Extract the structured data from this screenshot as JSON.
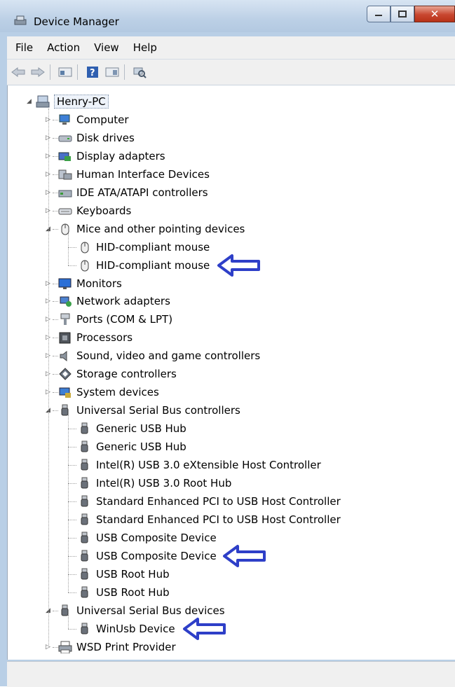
{
  "window": {
    "title": "Device Manager",
    "caption_buttons": [
      "minimize",
      "maximize",
      "close"
    ]
  },
  "menu": [
    "File",
    "Action",
    "View",
    "Help"
  ],
  "toolbar": [
    "back-icon",
    "forward-icon",
    "properties-icon",
    "help-icon",
    "update-driver-icon",
    "scan-hardware-icon"
  ],
  "tree": {
    "root": "Henry-PC",
    "categories": [
      {
        "label": "Computer",
        "icon": "computer-icon",
        "expanded": false
      },
      {
        "label": "Disk drives",
        "icon": "disk-drive-icon",
        "expanded": false
      },
      {
        "label": "Display adapters",
        "icon": "display-adapter-icon",
        "expanded": false
      },
      {
        "label": "Human Interface Devices",
        "icon": "hid-icon",
        "expanded": false
      },
      {
        "label": "IDE ATA/ATAPI controllers",
        "icon": "ide-controller-icon",
        "expanded": false
      },
      {
        "label": "Keyboards",
        "icon": "keyboard-icon",
        "expanded": false
      },
      {
        "label": "Mice and other pointing devices",
        "icon": "mouse-icon",
        "expanded": true,
        "children": [
          "HID-compliant mouse",
          "HID-compliant mouse"
        ]
      },
      {
        "label": "Monitors",
        "icon": "monitor-icon",
        "expanded": false
      },
      {
        "label": "Network adapters",
        "icon": "network-adapter-icon",
        "expanded": false
      },
      {
        "label": "Ports (COM & LPT)",
        "icon": "port-icon",
        "expanded": false
      },
      {
        "label": "Processors",
        "icon": "processor-icon",
        "expanded": false
      },
      {
        "label": "Sound, video and game controllers",
        "icon": "sound-icon",
        "expanded": false
      },
      {
        "label": "Storage controllers",
        "icon": "storage-controller-icon",
        "expanded": false
      },
      {
        "label": "System devices",
        "icon": "system-device-icon",
        "expanded": false
      },
      {
        "label": "Universal Serial Bus controllers",
        "icon": "usb-icon",
        "expanded": true,
        "children": [
          "Generic USB Hub",
          "Generic USB Hub",
          "Intel(R) USB 3.0 eXtensible Host Controller",
          "Intel(R) USB 3.0 Root Hub",
          "Standard Enhanced PCI to USB Host Controller",
          "Standard Enhanced PCI to USB Host Controller",
          "USB Composite Device",
          "USB Composite Device",
          "USB Root Hub",
          "USB Root Hub"
        ]
      },
      {
        "label": "Universal Serial Bus devices",
        "icon": "usb-icon",
        "expanded": true,
        "children": [
          "WinUsb Device"
        ]
      },
      {
        "label": "WSD Print Provider",
        "icon": "printer-icon",
        "expanded": false
      }
    ]
  },
  "annotation_color": "#2e3fc8",
  "highlighted_items": [
    "HID-compliant mouse",
    "USB Composite Device",
    "WinUsb Device"
  ]
}
